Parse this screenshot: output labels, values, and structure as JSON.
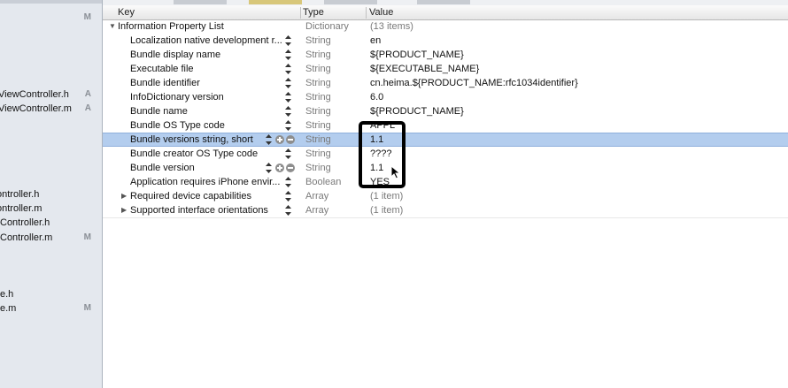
{
  "navigator": {
    "items": [
      {
        "name": "",
        "badge": "M"
      },
      {
        "name": "ViewController.h",
        "badge": "A"
      },
      {
        "name": "ViewController.m",
        "badge": "A"
      },
      {
        "name": "ontroller.h",
        "badge": ""
      },
      {
        "name": "ontroller.m",
        "badge": ""
      },
      {
        "name": "Controller.h",
        "badge": ""
      },
      {
        "name": "Controller.m",
        "badge": "M"
      },
      {
        "name": "e.h",
        "badge": ""
      },
      {
        "name": "e.m",
        "badge": "M"
      }
    ]
  },
  "header": {
    "key": "Key",
    "type": "Type",
    "value": "Value"
  },
  "root": {
    "key": "Information Property List",
    "type": "Dictionary",
    "value": "(13 items)"
  },
  "rows": [
    {
      "key": "Localization native development r...",
      "type": "String",
      "value": "en"
    },
    {
      "key": "Bundle display name",
      "type": "String",
      "value": "${PRODUCT_NAME}"
    },
    {
      "key": "Executable file",
      "type": "String",
      "value": "${EXECUTABLE_NAME}"
    },
    {
      "key": "Bundle identifier",
      "type": "String",
      "value": "cn.heima.${PRODUCT_NAME:rfc1034identifier}"
    },
    {
      "key": "InfoDictionary version",
      "type": "String",
      "value": "6.0"
    },
    {
      "key": "Bundle name",
      "type": "String",
      "value": "${PRODUCT_NAME}"
    },
    {
      "key": "Bundle OS Type code",
      "type": "String",
      "value": "APPL"
    },
    {
      "key": "Bundle versions string, short",
      "type": "String",
      "value": "1.1"
    },
    {
      "key": "Bundle creator OS Type code",
      "type": "String",
      "value": "????"
    },
    {
      "key": "Bundle version",
      "type": "String",
      "value": "1.1"
    },
    {
      "key": "Application requires iPhone envir...",
      "type": "Boolean",
      "value": "YES"
    },
    {
      "key": "Required device capabilities",
      "type": "Array",
      "value": "(1 item)"
    },
    {
      "key": "Supported interface orientations",
      "type": "Array",
      "value": "(1 item)"
    }
  ],
  "colors": {
    "selection": "#b3cdee",
    "highlight_box": "#000000"
  }
}
